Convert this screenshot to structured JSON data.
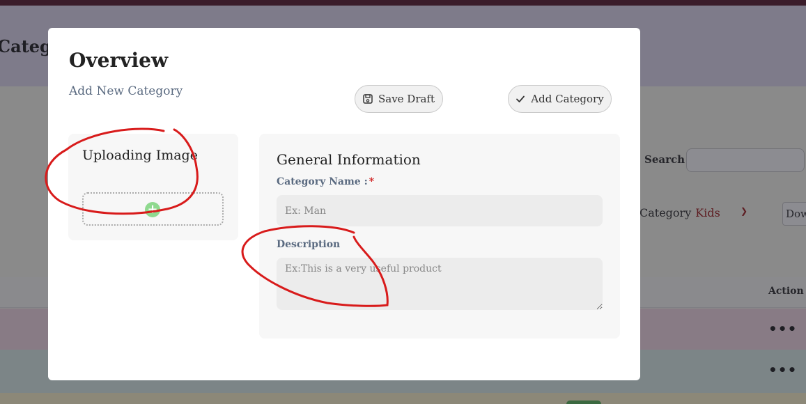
{
  "background": {
    "page_title": "Catego",
    "search": {
      "label": "Search",
      "value": ""
    },
    "filter": {
      "label": "Category",
      "value": "Kids"
    },
    "download_button": "Dow",
    "table": {
      "action_header": "Action",
      "row_menu": "•••"
    }
  },
  "modal": {
    "title": "Overview",
    "subtitle": "Add New Category",
    "buttons": {
      "save_draft": "Save Draft",
      "add_category": "Add Category"
    },
    "upload": {
      "title": "Uploading Image"
    },
    "general_info": {
      "title": "General Information",
      "category_name": {
        "label": "Category Name :",
        "required_mark": "*",
        "placeholder": "Ex: Man"
      },
      "description": {
        "label": "Description",
        "placeholder": "Ex:This is a very useful product"
      }
    }
  },
  "colors": {
    "annotation": "#d81b1b",
    "required": "#d02020",
    "label": "#5a6a80",
    "modal_bg": "#ffffff",
    "upload_plus": "#8fd98f"
  }
}
